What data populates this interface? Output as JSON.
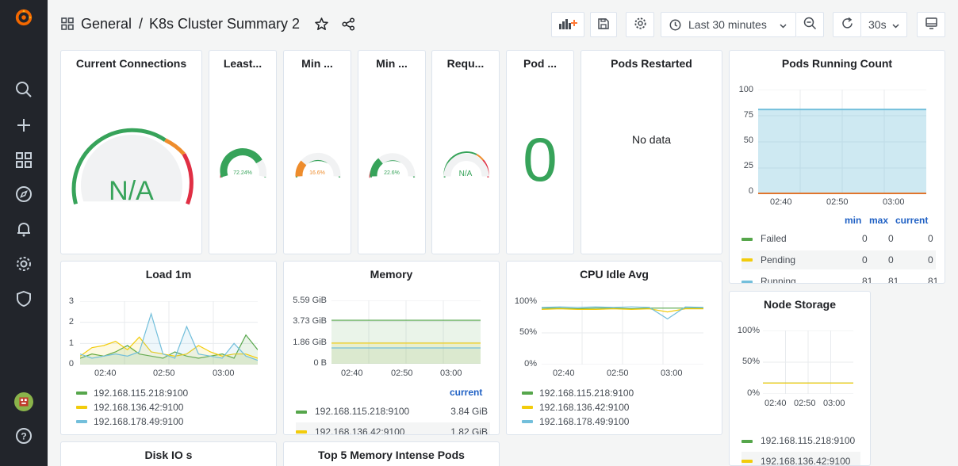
{
  "breadcrumb": {
    "folder": "General",
    "separator": "/",
    "dashboard": "K8s Cluster Summary 2"
  },
  "toolbar": {
    "time_range": "Last 30 minutes",
    "refresh_interval": "30s"
  },
  "colors": {
    "green": "#56a64b",
    "yellow": "#f2cc0c",
    "cyan": "#73bfdb",
    "red": "#e02f44",
    "orange": "#ff7834",
    "accent": "#1f60c4"
  },
  "panels": {
    "current_connections": {
      "title": "Current Connections",
      "value": "N/A"
    },
    "least": {
      "title": "Least...",
      "value": "72.24%",
      "fraction": 0.7224
    },
    "min1": {
      "title": "Min ...",
      "value": "16.6%",
      "fraction": 0.166
    },
    "min2": {
      "title": "Min ...",
      "value": "22.6%",
      "fraction": 0.226
    },
    "requ": {
      "title": "Requ...",
      "value": "N/A"
    },
    "pod": {
      "title": "Pod ...",
      "value": "0"
    },
    "pods_restarted": {
      "title": "Pods Restarted",
      "message": "No data"
    },
    "pods_running": {
      "title": "Pods Running Count",
      "y_ticks": [
        "100",
        "75",
        "50",
        "25",
        "0"
      ],
      "x_ticks": [
        "02:40",
        "02:50",
        "03:00"
      ],
      "legend_headers": {
        "min": "min",
        "max": "max",
        "current": "current"
      },
      "rows": [
        {
          "name": "Failed",
          "min": "0",
          "max": "0",
          "current": "0"
        },
        {
          "name": "Pending",
          "min": "0",
          "max": "0",
          "current": "0"
        },
        {
          "name": "Running",
          "min": "81",
          "max": "81",
          "current": "81"
        }
      ]
    },
    "load": {
      "title": "Load 1m",
      "y_ticks": [
        "3",
        "2",
        "1",
        "0"
      ],
      "x_ticks": [
        "02:40",
        "02:50",
        "03:00"
      ]
    },
    "memory": {
      "title": "Memory",
      "y_ticks": [
        "5.59 GiB",
        "3.73 GiB",
        "1.86 GiB",
        "0 B"
      ],
      "x_ticks": [
        "02:40",
        "02:50",
        "03:00"
      ],
      "legend_header": "current",
      "rows": [
        {
          "name": "192.168.115.218:9100",
          "current": "3.84 GiB"
        },
        {
          "name": "192.168.136.42:9100",
          "current": "1.82 GiB"
        }
      ]
    },
    "cpu": {
      "title": "CPU Idle Avg",
      "y_ticks": [
        "100%",
        "50%",
        "0%"
      ],
      "x_ticks": [
        "02:40",
        "02:50",
        "03:00"
      ]
    },
    "node_storage": {
      "title": "Node Storage",
      "y_ticks": [
        "100%",
        "50%",
        "0%"
      ],
      "x_ticks": [
        "02:40",
        "02:50",
        "03:00"
      ],
      "series": [
        "192.168.115.218:9100",
        "192.168.136.42:9100"
      ]
    },
    "disk_io": {
      "title": "Disk IO s"
    },
    "top5": {
      "title": "Top 5 Memory Intense Pods"
    }
  },
  "hosts": [
    "192.168.115.218:9100",
    "192.168.136.42:9100",
    "192.168.178.49:9100"
  ],
  "chart_data": [
    {
      "type": "area",
      "title": "Pods Running Count",
      "x": [
        "02:40",
        "02:50",
        "03:00"
      ],
      "ylim": [
        0,
        100
      ],
      "series": [
        {
          "name": "Failed",
          "values": [
            0,
            0,
            0
          ]
        },
        {
          "name": "Pending",
          "values": [
            0,
            0,
            0
          ]
        },
        {
          "name": "Running",
          "values": [
            81,
            81,
            81
          ]
        }
      ]
    },
    {
      "type": "line",
      "title": "Load 1m",
      "ylim": [
        0,
        3
      ],
      "x": [
        "02:36",
        "02:38",
        "02:40",
        "02:42",
        "02:44",
        "02:46",
        "02:48",
        "02:50",
        "02:52",
        "02:54",
        "02:56",
        "02:58",
        "03:00",
        "03:02",
        "03:04",
        "03:06"
      ],
      "series": [
        {
          "name": "192.168.115.218:9100",
          "values": [
            0.3,
            0.5,
            0.4,
            0.6,
            0.9,
            0.5,
            0.4,
            0.3,
            0.6,
            0.4,
            0.3,
            0.4,
            0.5,
            0.3,
            1.4,
            0.7
          ]
        },
        {
          "name": "192.168.136.42:9100",
          "values": [
            0.4,
            0.8,
            0.9,
            1.1,
            0.7,
            1.3,
            0.6,
            0.5,
            0.4,
            0.5,
            0.9,
            0.6,
            0.4,
            0.5,
            0.5,
            0.3
          ]
        },
        {
          "name": "192.168.178.49:9100",
          "values": [
            0.5,
            0.3,
            0.4,
            0.5,
            0.4,
            0.6,
            2.4,
            0.5,
            0.3,
            1.8,
            0.5,
            0.4,
            0.3,
            1.0,
            0.4,
            0.2
          ]
        }
      ]
    },
    {
      "type": "line",
      "title": "Memory",
      "ylim": [
        0,
        5.59
      ],
      "x": [
        "02:36",
        "03:06"
      ],
      "series": [
        {
          "name": "192.168.115.218:9100",
          "values": [
            3.84,
            3.84
          ]
        },
        {
          "name": "192.168.136.42:9100",
          "values": [
            1.82,
            1.82
          ]
        },
        {
          "name": "192.168.178.49:9100",
          "values": [
            1.4,
            1.4
          ]
        }
      ]
    },
    {
      "type": "line",
      "title": "CPU Idle Avg",
      "ylim": [
        0,
        100
      ],
      "x": [
        "02:36",
        "02:40",
        "02:44",
        "02:48",
        "02:52",
        "02:56",
        "03:00",
        "03:02",
        "03:04",
        "03:06"
      ],
      "series": [
        {
          "name": "192.168.115.218:9100",
          "values": [
            89,
            89,
            88,
            89,
            89,
            88,
            89,
            89,
            89,
            89
          ]
        },
        {
          "name": "192.168.136.42:9100",
          "values": [
            87,
            88,
            87,
            87,
            88,
            87,
            88,
            83,
            88,
            88
          ]
        },
        {
          "name": "192.168.178.49:9100",
          "values": [
            90,
            91,
            90,
            91,
            90,
            91,
            90,
            72,
            91,
            90
          ]
        }
      ]
    },
    {
      "type": "line",
      "title": "Node Storage",
      "ylim": [
        0,
        100
      ],
      "x": [
        "02:36",
        "03:06"
      ],
      "series": [
        {
          "name": "192.168.115.218:9100",
          "values": [
            17,
            17
          ]
        },
        {
          "name": "192.168.136.42:9100",
          "values": [
            17,
            17
          ]
        }
      ]
    }
  ]
}
